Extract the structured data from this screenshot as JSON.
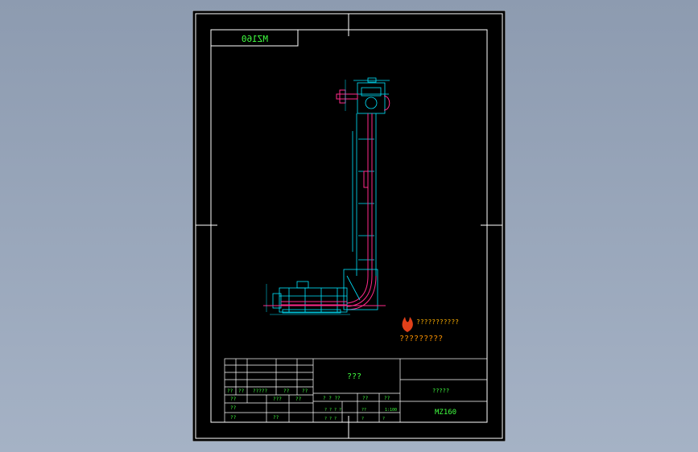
{
  "drawing": {
    "mirrored_label": "MZ160",
    "title_center": "???",
    "drawing_code": "MZ160",
    "company_code": "?????",
    "scale": "1:100",
    "watermark_line1": "???????????",
    "watermark_line2": "?????????"
  },
  "title_block": {
    "row1": [
      "??",
      "??",
      "?????",
      "??",
      "??"
    ],
    "row2": [
      "??",
      "???",
      "??"
    ],
    "row3": [
      "? ? ??",
      "??",
      "??"
    ],
    "row4": [
      "??",
      "??"
    ],
    "row5": [
      "? ? ? ?",
      "??",
      "? ? ?",
      "?",
      "?"
    ],
    "row6": [
      "??",
      "??"
    ]
  },
  "colors": {
    "background": "#000000",
    "frame": "#ffffff",
    "cyan": "#00e5ff",
    "magenta": "#ff2a8a",
    "green": "#40ff40",
    "yellow": "#ffff30"
  }
}
